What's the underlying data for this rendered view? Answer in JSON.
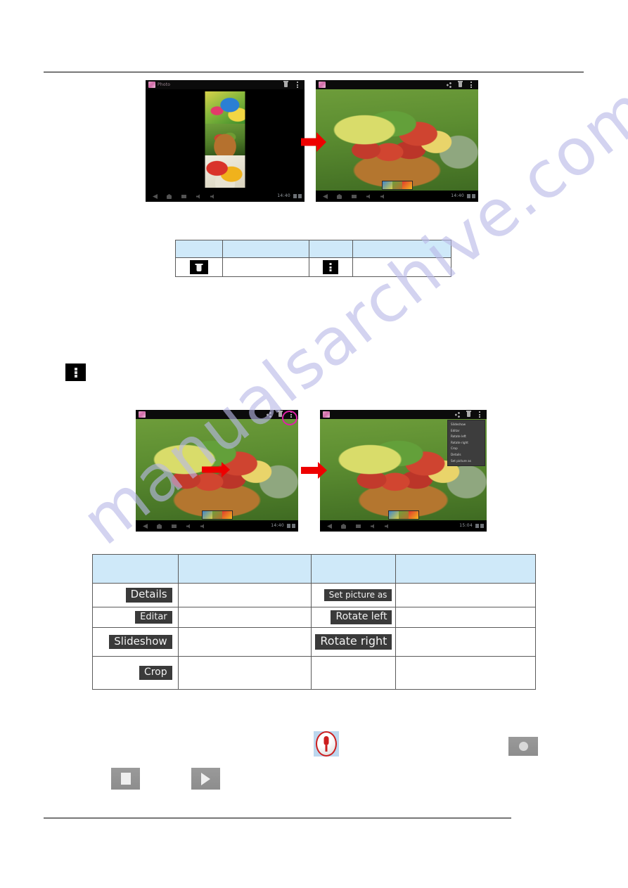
{
  "page": {
    "watermark_text": "manualsarchive.com",
    "watermark_color": "#b9b9e8",
    "accent_red": "#ee0000",
    "accent_magenta": "#e020a8",
    "table_header_color": "#cfe9f9"
  },
  "figure_one": {
    "left_tablet": {
      "app_title": "Photo",
      "clock": "14:40",
      "statusbar_icons": [
        "photo-app-icon",
        "delete-icon",
        "overflow-menu-icon"
      ],
      "navbar_icons": [
        "back-icon",
        "home-icon",
        "recents-icon",
        "volume-down-icon",
        "volume-up-icon"
      ],
      "thumbnails": [
        "butterfly-photo",
        "fruit-bowl-photo",
        "peppers-photo"
      ]
    },
    "right_tablet": {
      "app_title": "",
      "clock": "14:40",
      "statusbar_icons": [
        "photo-app-icon",
        "share-icon",
        "delete-icon",
        "overflow-menu-icon"
      ],
      "navbar_icons": [
        "back-icon",
        "home-icon",
        "recents-icon",
        "volume-down-icon",
        "volume-up-icon"
      ],
      "photo": "fruit-bowl-photo"
    },
    "arrow": "red-right-arrow"
  },
  "table_one": {
    "header_cells": [
      "",
      "",
      "",
      ""
    ],
    "rows": [
      {
        "icon_1": "delete-icon",
        "text_1": "",
        "icon_2": "overflow-menu-icon",
        "text_2": ""
      }
    ]
  },
  "standalone_icon": {
    "name": "overflow-menu-icon"
  },
  "figure_two": {
    "left_tablet": {
      "app_title": "",
      "clock": "14:40",
      "statusbar_icons": [
        "photo-app-icon",
        "share-icon",
        "delete-icon",
        "overflow-menu-icon"
      ],
      "highlight": "overflow-menu-highlight-circle",
      "photo": "fruit-bowl-photo"
    },
    "right_tablet": {
      "app_title": "",
      "clock": "15:04",
      "statusbar_icons": [
        "photo-app-icon",
        "share-icon",
        "delete-icon",
        "overflow-menu-icon"
      ],
      "photo": "fruit-bowl-photo",
      "dropdown_menu": [
        "Slideshow",
        "Editar",
        "Rotate left",
        "Rotate right",
        "Crop",
        "Details",
        "Set picture as"
      ]
    },
    "arrow_inner": "red-right-arrow",
    "arrow_between": "red-right-arrow"
  },
  "table_two": {
    "header_cells": [
      "",
      "",
      "",
      ""
    ],
    "rows": [
      {
        "chip_left": "Details",
        "desc_left": "",
        "chip_right": "Set picture as",
        "desc_right": ""
      },
      {
        "chip_left": "Editar",
        "desc_left": "",
        "chip_right": "Rotate left",
        "desc_right": ""
      },
      {
        "chip_left": "Slideshow",
        "desc_left": "",
        "chip_right": "Rotate right",
        "desc_right": ""
      },
      {
        "chip_left": "Crop",
        "desc_left": "",
        "chip_right": "",
        "desc_right": ""
      }
    ]
  },
  "recorder_controls": {
    "mic": "microphone-icon",
    "record": "record-button-icon",
    "stop": "stop-button-icon",
    "play": "play-button-icon"
  }
}
